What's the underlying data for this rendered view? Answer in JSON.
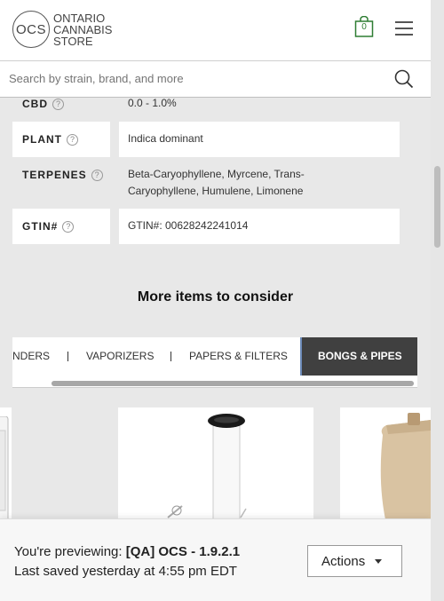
{
  "header": {
    "logo_mark": "OCS",
    "logo_line1": "ONTARIO",
    "logo_line2": "CANNABIS",
    "logo_line3": "STORE",
    "cart_count": "0",
    "cart_color": "#2e7d32"
  },
  "search": {
    "placeholder": "Search by strain, brand, and more"
  },
  "attributes": {
    "cbd_label": "CBD",
    "cbd_value": "0.0 - 1.0%",
    "plant_label": "PLANT",
    "plant_value": "Indica dominant",
    "terpenes_label": "TERPENES",
    "terpenes_value_line1": "Beta-Caryophyllene, Myrcene, Trans-",
    "terpenes_value_line2": "Caryophyllene, Humulene, Limonene",
    "gtin_label": "GTIN#",
    "gtin_value": "GTIN#: 00628242241014",
    "help_glyph": "?"
  },
  "more_items": {
    "title": "More items to consider",
    "tabs": [
      "NDERS",
      "VAPORIZERS",
      "PAPERS & FILTERS",
      "BONGS & PIPES"
    ],
    "active_tab": "BONGS & PIPES",
    "active_color": "#404040"
  },
  "preview": {
    "prefix": "You're previewing: ",
    "name": "[QA] OCS - 1.9.2.1",
    "saved": "Last saved yesterday at 4:55 pm EDT",
    "actions_label": "Actions"
  },
  "icons": {
    "cart": "shopping-bag-icon",
    "menu": "hamburger-icon",
    "search": "search-icon",
    "help": "question-circle-icon",
    "actions": "caret-down-icon"
  }
}
